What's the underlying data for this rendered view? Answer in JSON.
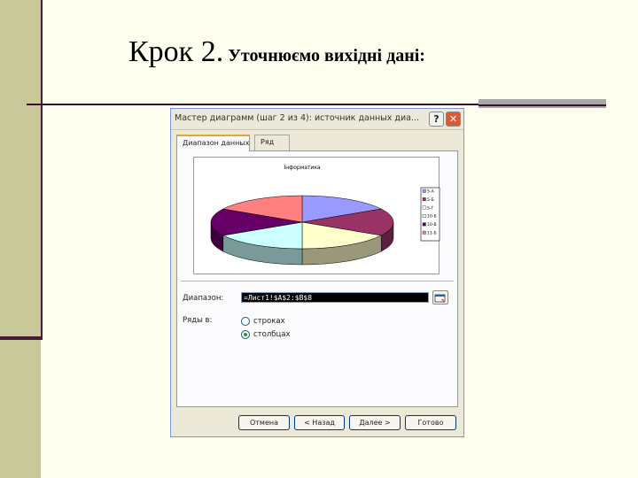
{
  "slide": {
    "title_big": "Крок 2.",
    "title_small": " Уточнюємо вихідні дані:"
  },
  "dialog": {
    "title": "Мастер диаграмм (шаг 2 из 4): источник данных диа...",
    "help_label": "?",
    "close_label": "✕",
    "tabs": [
      {
        "label": "Диапазон данных",
        "active": true
      },
      {
        "label": "Ряд",
        "active": false
      }
    ],
    "preview": {
      "title": "Інформатика"
    },
    "range_label": "Диапазон:",
    "range_value": "=Лист1!$A$2:$B$8",
    "series_in_label": "Ряды в:",
    "series_options": [
      {
        "label": "строках",
        "selected": false
      },
      {
        "label": "столбцах",
        "selected": true
      }
    ],
    "buttons": {
      "cancel": "Отмена",
      "back": "< Назад",
      "next": "Далее >",
      "finish": "Готово"
    }
  },
  "chart_data": {
    "type": "pie",
    "title": "Інформатика",
    "labels": [
      "5-А",
      "5-Б",
      "5-Г",
      "10-Б",
      "10-В",
      "11-Б"
    ],
    "values": [
      1,
      1,
      1,
      1,
      1,
      1
    ],
    "colors": [
      "#9999ff",
      "#993366",
      "#ffffcc",
      "#ccffff",
      "#660066",
      "#ff8080"
    ],
    "legend_position": "right",
    "style": "3d"
  }
}
